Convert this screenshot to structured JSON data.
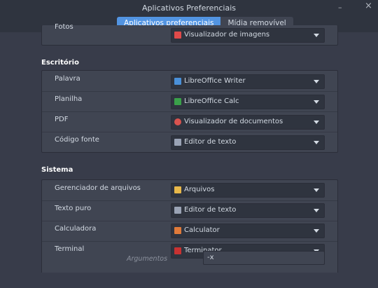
{
  "window": {
    "title": "Aplicativos Preferenciais",
    "minimize_glyph": "–",
    "close_glyph": "×"
  },
  "tabs": [
    {
      "label": "Aplicativos preferenciais",
      "active": true
    },
    {
      "label": "Mídia removível",
      "active": false
    }
  ],
  "partial_row": {
    "label": "Fotos",
    "value": "Visualizador de imagens",
    "icon": "image-viewer-icon",
    "color": "#e04a4a"
  },
  "office": {
    "title": "Escritório",
    "rows": [
      {
        "label": "Palavra",
        "value": "LibreOffice Writer",
        "icon": "writer-icon",
        "color": "#4a90d9"
      },
      {
        "label": "Planilha",
        "value": "LibreOffice Calc",
        "icon": "calc-icon",
        "color": "#3aa14a"
      },
      {
        "label": "PDF",
        "value": "Visualizador de documentos",
        "icon": "document-viewer-icon",
        "color": "#d9534f"
      },
      {
        "label": "Código fonte",
        "value": "Editor de texto",
        "icon": "text-editor-icon",
        "color": "#9aa3b5"
      }
    ]
  },
  "system": {
    "title": "Sistema",
    "rows": [
      {
        "label": "Gerenciador de arquivos",
        "value": "Arquivos",
        "icon": "folder-icon",
        "color": "#e8b84a"
      },
      {
        "label": "Texto puro",
        "value": "Editor de texto",
        "icon": "text-editor-icon",
        "color": "#9aa3b5"
      },
      {
        "label": "Calculadora",
        "value": "Calculator",
        "icon": "calculator-icon",
        "color": "#e07a3a"
      },
      {
        "label": "Terminal",
        "value": "Terminator",
        "icon": "terminal-icon",
        "color": "#c83232"
      }
    ],
    "arguments_label": "Argumentos",
    "arguments_value": "-x"
  }
}
